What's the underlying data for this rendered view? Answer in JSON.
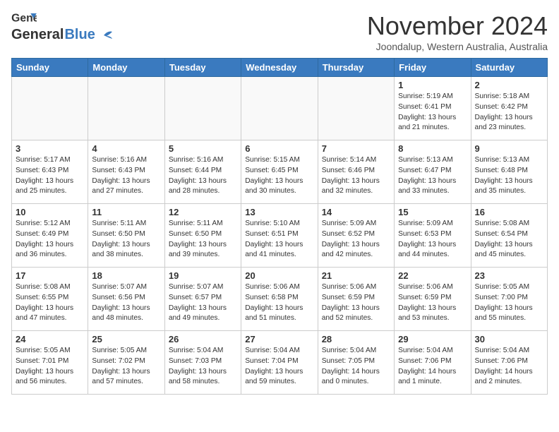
{
  "header": {
    "logo_line1": "General",
    "logo_line2": "Blue",
    "month_title": "November 2024",
    "subtitle": "Joondalup, Western Australia, Australia"
  },
  "days_of_week": [
    "Sunday",
    "Monday",
    "Tuesday",
    "Wednesday",
    "Thursday",
    "Friday",
    "Saturday"
  ],
  "weeks": [
    [
      {
        "day": "",
        "info": ""
      },
      {
        "day": "",
        "info": ""
      },
      {
        "day": "",
        "info": ""
      },
      {
        "day": "",
        "info": ""
      },
      {
        "day": "",
        "info": ""
      },
      {
        "day": "1",
        "info": "Sunrise: 5:19 AM\nSunset: 6:41 PM\nDaylight: 13 hours\nand 21 minutes."
      },
      {
        "day": "2",
        "info": "Sunrise: 5:18 AM\nSunset: 6:42 PM\nDaylight: 13 hours\nand 23 minutes."
      }
    ],
    [
      {
        "day": "3",
        "info": "Sunrise: 5:17 AM\nSunset: 6:43 PM\nDaylight: 13 hours\nand 25 minutes."
      },
      {
        "day": "4",
        "info": "Sunrise: 5:16 AM\nSunset: 6:43 PM\nDaylight: 13 hours\nand 27 minutes."
      },
      {
        "day": "5",
        "info": "Sunrise: 5:16 AM\nSunset: 6:44 PM\nDaylight: 13 hours\nand 28 minutes."
      },
      {
        "day": "6",
        "info": "Sunrise: 5:15 AM\nSunset: 6:45 PM\nDaylight: 13 hours\nand 30 minutes."
      },
      {
        "day": "7",
        "info": "Sunrise: 5:14 AM\nSunset: 6:46 PM\nDaylight: 13 hours\nand 32 minutes."
      },
      {
        "day": "8",
        "info": "Sunrise: 5:13 AM\nSunset: 6:47 PM\nDaylight: 13 hours\nand 33 minutes."
      },
      {
        "day": "9",
        "info": "Sunrise: 5:13 AM\nSunset: 6:48 PM\nDaylight: 13 hours\nand 35 minutes."
      }
    ],
    [
      {
        "day": "10",
        "info": "Sunrise: 5:12 AM\nSunset: 6:49 PM\nDaylight: 13 hours\nand 36 minutes."
      },
      {
        "day": "11",
        "info": "Sunrise: 5:11 AM\nSunset: 6:50 PM\nDaylight: 13 hours\nand 38 minutes."
      },
      {
        "day": "12",
        "info": "Sunrise: 5:11 AM\nSunset: 6:50 PM\nDaylight: 13 hours\nand 39 minutes."
      },
      {
        "day": "13",
        "info": "Sunrise: 5:10 AM\nSunset: 6:51 PM\nDaylight: 13 hours\nand 41 minutes."
      },
      {
        "day": "14",
        "info": "Sunrise: 5:09 AM\nSunset: 6:52 PM\nDaylight: 13 hours\nand 42 minutes."
      },
      {
        "day": "15",
        "info": "Sunrise: 5:09 AM\nSunset: 6:53 PM\nDaylight: 13 hours\nand 44 minutes."
      },
      {
        "day": "16",
        "info": "Sunrise: 5:08 AM\nSunset: 6:54 PM\nDaylight: 13 hours\nand 45 minutes."
      }
    ],
    [
      {
        "day": "17",
        "info": "Sunrise: 5:08 AM\nSunset: 6:55 PM\nDaylight: 13 hours\nand 47 minutes."
      },
      {
        "day": "18",
        "info": "Sunrise: 5:07 AM\nSunset: 6:56 PM\nDaylight: 13 hours\nand 48 minutes."
      },
      {
        "day": "19",
        "info": "Sunrise: 5:07 AM\nSunset: 6:57 PM\nDaylight: 13 hours\nand 49 minutes."
      },
      {
        "day": "20",
        "info": "Sunrise: 5:06 AM\nSunset: 6:58 PM\nDaylight: 13 hours\nand 51 minutes."
      },
      {
        "day": "21",
        "info": "Sunrise: 5:06 AM\nSunset: 6:59 PM\nDaylight: 13 hours\nand 52 minutes."
      },
      {
        "day": "22",
        "info": "Sunrise: 5:06 AM\nSunset: 6:59 PM\nDaylight: 13 hours\nand 53 minutes."
      },
      {
        "day": "23",
        "info": "Sunrise: 5:05 AM\nSunset: 7:00 PM\nDaylight: 13 hours\nand 55 minutes."
      }
    ],
    [
      {
        "day": "24",
        "info": "Sunrise: 5:05 AM\nSunset: 7:01 PM\nDaylight: 13 hours\nand 56 minutes."
      },
      {
        "day": "25",
        "info": "Sunrise: 5:05 AM\nSunset: 7:02 PM\nDaylight: 13 hours\nand 57 minutes."
      },
      {
        "day": "26",
        "info": "Sunrise: 5:04 AM\nSunset: 7:03 PM\nDaylight: 13 hours\nand 58 minutes."
      },
      {
        "day": "27",
        "info": "Sunrise: 5:04 AM\nSunset: 7:04 PM\nDaylight: 13 hours\nand 59 minutes."
      },
      {
        "day": "28",
        "info": "Sunrise: 5:04 AM\nSunset: 7:05 PM\nDaylight: 14 hours\nand 0 minutes."
      },
      {
        "day": "29",
        "info": "Sunrise: 5:04 AM\nSunset: 7:06 PM\nDaylight: 14 hours\nand 1 minute."
      },
      {
        "day": "30",
        "info": "Sunrise: 5:04 AM\nSunset: 7:06 PM\nDaylight: 14 hours\nand 2 minutes."
      }
    ]
  ]
}
